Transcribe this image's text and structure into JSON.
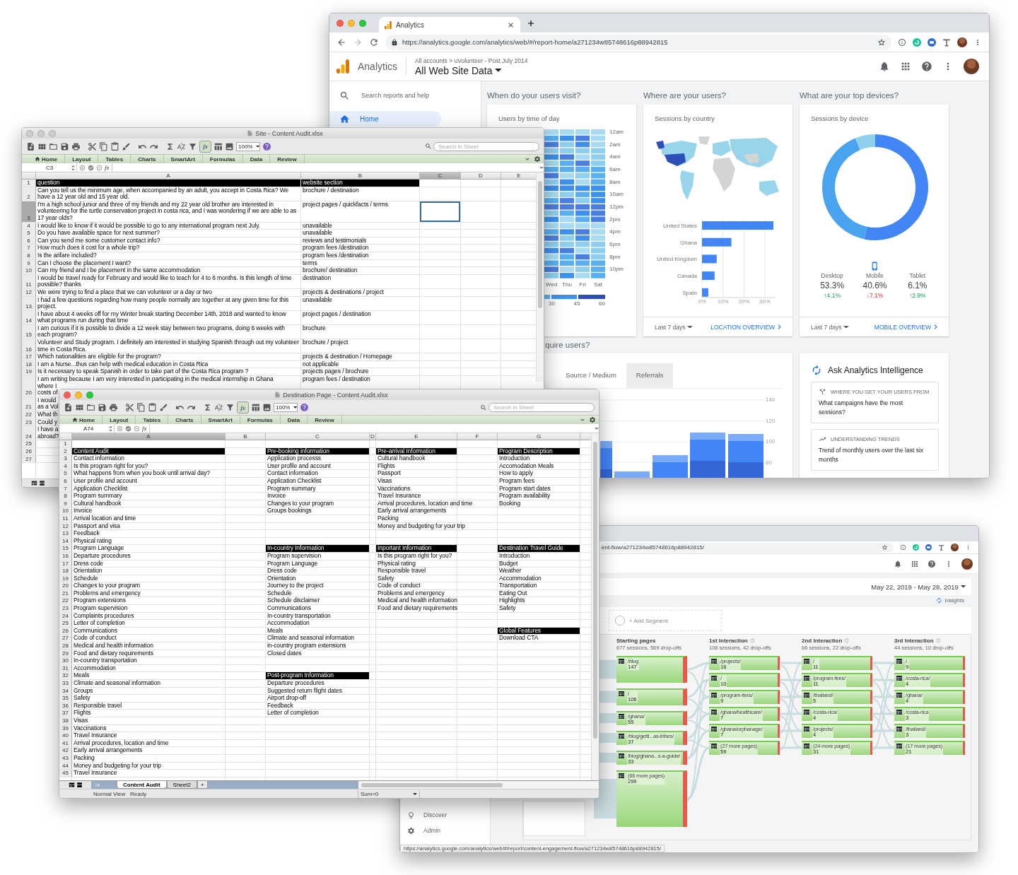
{
  "analytics_window": {
    "tab": {
      "title": "Analytics"
    },
    "url": "https://analytics.google.com/analytics/web/#/report-home/a271234w85748616p88942815",
    "product": "Analytics",
    "breadcrumb": "All accounts > uVolunteer - Post July 2014",
    "view": "All Web Site Data",
    "search": {
      "placeholder": "Search reports and help"
    },
    "sidebar": {
      "items": [
        {
          "label": "Home",
          "selected": true
        }
      ]
    },
    "sections": [
      "When do your users visit?",
      "Where are your users?",
      "What are your top devices?"
    ],
    "time_card": {
      "title": "Users by time of day",
      "hours": [
        "12am",
        "2am",
        "4am",
        "6am",
        "8am",
        "10am",
        "12pm",
        "2pm",
        "4pm",
        "6pm",
        "8pm",
        "10pm"
      ],
      "days": [
        "Wed",
        "Thu",
        "Fri",
        "Sat"
      ],
      "legend": [
        "30",
        "45",
        "60"
      ]
    },
    "country_card": {
      "title": "Sessions by country",
      "range": "Last 7 days",
      "link": "LOCATION OVERVIEW",
      "chart_data": {
        "type": "bar",
        "orientation": "horizontal",
        "grid": true,
        "xlim": [
          0,
          35
        ],
        "categories": [
          "United States",
          "Ghana",
          "United Kingdom",
          "Canada",
          "Spain"
        ],
        "values": [
          34,
          14,
          7,
          6,
          3
        ],
        "xticks": [
          {
            "value": 0,
            "label": "0%"
          },
          {
            "value": 10,
            "label": "10%"
          },
          {
            "value": 20,
            "label": "20%"
          },
          {
            "value": 30,
            "label": "30%"
          }
        ]
      }
    },
    "device_card": {
      "title": "Sessions by device",
      "range": "Last 7 days",
      "link": "MOBILE OVERVIEW",
      "chart_data": {
        "type": "donut",
        "categories": [
          "Desktop",
          "Mobile",
          "Tablet"
        ],
        "values": [
          53.3,
          40.6,
          6.1
        ]
      },
      "devices": [
        {
          "value": "53.3%",
          "change": "↑4.1%",
          "increase": true,
          "selected": false
        },
        {
          "value": "40.6%",
          "change": "↓7.1%",
          "increase": false,
          "selected": true
        },
        {
          "value": "6.1%",
          "change": "↑2.9%",
          "increase": true,
          "selected": false
        }
      ]
    },
    "acquisition": {
      "heading": "quire users?",
      "tabs": [
        {
          "label": "Source / Medium",
          "selected": false,
          "hovered": false
        },
        {
          "label": "Referrals",
          "selected": false,
          "hovered": true
        }
      ],
      "y_labels": [
        "140",
        "120",
        "100",
        "80"
      ]
    },
    "intelligence": {
      "title": "Ask Analytics Intelligence",
      "cards": [
        {
          "kind": "source",
          "topic": "WHERE YOU GET YOUR USERS FROM",
          "question": "What campaigns have the most sessions?"
        },
        {
          "kind": "trend",
          "topic": "UNDERSTANDING TRENDS",
          "question": "Trend of monthly users over the last six months"
        }
      ]
    }
  },
  "flow_window": {
    "url": "ent-flow/a271234w85748616p88942815/",
    "date_range": "May 22, 2019 - May 28, 2019",
    "insights": "Insights",
    "segment": "+ Add Segment",
    "sidebar": {
      "items": [
        {
          "label": "Discover",
          "kind": "discover"
        },
        {
          "label": "Admin",
          "kind": "admin"
        }
      ]
    },
    "columns": [
      {
        "title": "Starting pages",
        "summary": "677 sessions, 569 drop-offs",
        "nodes": [
          {
            "page": "/blog",
            "sessions": "147"
          },
          {
            "page": "/",
            "sessions": "106"
          },
          {
            "page": "/ghana/",
            "sessions": "55"
          },
          {
            "page": "/blog/getti...as-tribes/",
            "sessions": "37"
          },
          {
            "page": "/blog/ghana...s-a-guide/",
            "sessions": "33"
          },
          {
            "page": "(66 more pages)",
            "sessions": "299"
          }
        ]
      },
      {
        "title": "1st Interaction",
        "summary": "108 sessions, 42 drop-offs",
        "nodes": [
          {
            "page": "/projects/",
            "sessions": "16"
          },
          {
            "page": "/",
            "sessions": "10"
          },
          {
            "page": "/program-fees/",
            "sessions": "9"
          },
          {
            "page": "/ghana/healthcare/",
            "sessions": "7"
          },
          {
            "page": "/ghana/orphanage/",
            "sessions": "7"
          },
          {
            "page": "(27 more pages)",
            "sessions": "59"
          }
        ]
      },
      {
        "title": "2nd Interaction",
        "summary": "66 sessions, 22 drop-offs",
        "nodes": [
          {
            "page": "/",
            "sessions": "11"
          },
          {
            "page": "/program-fees/",
            "sessions": "11"
          },
          {
            "page": "/thailand/",
            "sessions": "5"
          },
          {
            "page": "/costa-rica/",
            "sessions": "4"
          },
          {
            "page": "/projects/",
            "sessions": "4"
          },
          {
            "page": "(24 more pages)",
            "sessions": "31"
          }
        ]
      },
      {
        "title": "3rd Interaction",
        "summary": "44 sessions, 10 drop-offs",
        "nodes": [
          {
            "page": "/",
            "sessions": "9"
          },
          {
            "page": "/costa-rica/",
            "sessions": "4"
          },
          {
            "page": "/ghana/",
            "sessions": "4"
          },
          {
            "page": "/costa-rica",
            "sessions": "3"
          },
          {
            "page": "/thailand/",
            "sessions": "3"
          },
          {
            "page": "(17 more pages)",
            "sessions": "21"
          }
        ]
      }
    ],
    "status_url": "https://analytics.google.com/analytics/web/#/report/content-engagement-flow/a271234w85748616p88942815/"
  },
  "site_sheet": {
    "title": "Site - Content Audit.xlsx",
    "active": false,
    "zoom": "100%",
    "toolbar_fx": "fx",
    "formula_fx": "fx",
    "search": {
      "placeholder": "Search in Sheet"
    },
    "ribbon": [
      "Home",
      "Layout",
      "Tables",
      "Charts",
      "SmartArt",
      "Formulas",
      "Data",
      "Review"
    ],
    "cell_ref": "C3",
    "columns": [
      {
        "label": "A",
        "selected": false
      },
      {
        "label": "B",
        "selected": false
      },
      {
        "label": "C",
        "selected": true
      },
      {
        "label": "D",
        "selected": false
      },
      {
        "label": "E",
        "selected": false
      }
    ],
    "rows": [
      {
        "number": "1",
        "selected": false,
        "kind": "header",
        "question": "question",
        "section": "website section"
      },
      {
        "number": "2",
        "selected": false,
        "kind": "plain",
        "question": "Can you tell us the minimum age, when accompanied by an adult, you accept in Costa Rica? We have a 12 year old and 15 year old.",
        "section": "brochure / destination"
      },
      {
        "number": "3",
        "selected": true,
        "kind": "plain",
        "question": "I'm a high school junior and three of my friends and my 22 year old brother are interested in volunteering for the turtle conservation project in costa rica, and I was wondering if we are able to as 17 year olds?",
        "section": "project pages / quickfacts / terms"
      },
      {
        "number": "4",
        "selected": false,
        "kind": "plain",
        "question": "I would like to know if it would be possible to go to any international program next July.",
        "section": "unavailable"
      },
      {
        "number": "5",
        "selected": false,
        "kind": "plain",
        "question": "Do you have available space for next summer?",
        "section": "unavailable"
      },
      {
        "number": "6",
        "selected": false,
        "kind": "plain",
        "question": "Can you send me some customer contact info?",
        "section": "reviews and testimonials"
      },
      {
        "number": "7",
        "selected": false,
        "kind": "plain",
        "question": "How much does it cost for a whole trip?",
        "section": "program fees /destination"
      },
      {
        "number": "8",
        "selected": false,
        "kind": "plain",
        "question": "Is the arifare included?",
        "section": "program fees /destination"
      },
      {
        "number": "9",
        "selected": false,
        "kind": "plain",
        "question": "Can I choose the placement I want?",
        "section": "terms"
      },
      {
        "number": "10",
        "selected": false,
        "kind": "plain",
        "question": "Can my friend and  I be placement in the same accommodation",
        "section": "brochure/ destination"
      },
      {
        "number": "11",
        "selected": false,
        "kind": "plain",
        "question": "I would be travel ready for February and would like to teach for 4 to 6 months. Is this length of time possible? thanks",
        "section": "destination"
      },
      {
        "number": "12",
        "selected": false,
        "kind": "plain",
        "question": "We were trying to find a place that we can volunteer or a day or two",
        "section": "projects & destinations / project"
      },
      {
        "number": "13",
        "selected": false,
        "kind": "plain",
        "question": "I had a few questions regarding how many people normally are together at any given time for this project.",
        "section": "unavailable"
      },
      {
        "number": "14",
        "selected": false,
        "kind": "plain",
        "question": "I have about 4 weeks off for my Winter break starting December 14th, 2018 and wanted to know what programs run during that time",
        "section": "project pages / destination"
      },
      {
        "number": "15",
        "selected": false,
        "kind": "plain",
        "question": "I am curious if it is possible to divide a 12 week stay between two programs, doing 6 weeks with each program?",
        "section": "brochure"
      },
      {
        "number": "16",
        "selected": false,
        "kind": "plain",
        "question": "Volunteer and Study program. I definitely am interested in studying Spanish through out my volunteer time in Costa Rica.",
        "section": "brochure / project"
      },
      {
        "number": "17",
        "selected": false,
        "kind": "plain",
        "question": "Which nationalities are eligible for the program?",
        "section": "projects & destination / Homepage"
      },
      {
        "number": "18",
        "selected": false,
        "kind": "plain",
        "question": "I am a Nurse...thus can help with medical education in Costa Rica",
        "section": "not applicable"
      },
      {
        "number": "19",
        "selected": false,
        "kind": "plain",
        "question": "Is it necessary to speak Spanish in order to take part of the Costa Rica program ?",
        "section": "projects pages / brochure"
      },
      {
        "number": "20",
        "selected": false,
        "kind": "plain",
        "question_lines": [
          "I am writing because I am very interested in participating in the medical internship in Ghana",
          "where I",
          "costs of"
        ],
        "section": "program fees / destination"
      },
      {
        "number": "21",
        "selected": false,
        "kind": "plain",
        "question_lines": [
          "I would",
          "as a Vol"
        ]
      },
      {
        "number": "22",
        "selected": false,
        "kind": "plain",
        "question_lines": [
          "What th"
        ]
      },
      {
        "number": "23",
        "selected": false,
        "kind": "plain",
        "question_lines": [
          "Could y"
        ]
      },
      {
        "number": "24",
        "selected": false,
        "kind": "plain",
        "question_lines": [
          "I have a",
          "abroad?"
        ]
      },
      {
        "number": "25",
        "selected": false,
        "kind": "plain"
      },
      {
        "number": "26",
        "selected": false,
        "kind": "plain"
      },
      {
        "number": "27",
        "selected": false,
        "kind": "plain"
      }
    ]
  },
  "dest_sheet": {
    "title": "Destination Page - Content Audit.xlsx",
    "active": true,
    "zoom": "100%",
    "toolbar_fx": "fx",
    "formula_fx": "fx",
    "search": {
      "placeholder": "Search in Sheet"
    },
    "ribbon": [
      "Home",
      "Layout",
      "Tables",
      "Charts",
      "SmartArt",
      "Formulas",
      "Data",
      "Review"
    ],
    "cell_ref": "A74",
    "columns": [
      {
        "label": "A",
        "selected": true
      },
      {
        "label": "B",
        "selected": false
      },
      {
        "label": "C",
        "selected": false
      },
      {
        "label": "D",
        "selected": false
      },
      {
        "label": "E",
        "selected": false
      },
      {
        "label": "F",
        "selected": false
      },
      {
        "label": "G",
        "selected": false
      }
    ],
    "rows": [
      {
        "number": "1",
        "selected": false
      },
      {
        "number": "2",
        "selected": false,
        "cells": {
          "a": {
            "text": "Content Audit",
            "kind": "header"
          },
          "c": {
            "text": "Pre-booking information",
            "kind": "header"
          },
          "e": {
            "text": "Pre-arrival Information",
            "kind": "header"
          },
          "g": {
            "text": "Program Description",
            "kind": "header"
          }
        }
      },
      {
        "number": "3",
        "selected": false,
        "cells": {
          "a": {
            "text": "Contact information",
            "kind": "plain"
          },
          "c": {
            "text": "Application processs",
            "kind": "plain"
          },
          "e": {
            "text": "Cultural handbook",
            "kind": "plain"
          },
          "g": {
            "text": "Introduction",
            "kind": "plain"
          }
        }
      },
      {
        "number": "4",
        "selected": false,
        "cells": {
          "a": {
            "text": "Is this program right for you?",
            "kind": "plain"
          },
          "c": {
            "text": "User profile and account",
            "kind": "plain"
          },
          "e": {
            "text": "Flights",
            "kind": "plain"
          },
          "g": {
            "text": "Accomodation Meals",
            "kind": "plain"
          }
        }
      },
      {
        "number": "5",
        "selected": false,
        "cells": {
          "a": {
            "text": "What happens from when you book until arrival day?",
            "kind": "plain"
          },
          "c": {
            "text": "Contact information",
            "kind": "plain"
          },
          "e": {
            "text": "Passport",
            "kind": "plain"
          },
          "g": {
            "text": "How to apply",
            "kind": "plain"
          }
        }
      },
      {
        "number": "6",
        "selected": false,
        "cells": {
          "a": {
            "text": "User profile and account",
            "kind": "plain"
          },
          "c": {
            "text": "Application Checklist",
            "kind": "plain"
          },
          "e": {
            "text": "Visas",
            "kind": "plain"
          },
          "g": {
            "text": "Program fees",
            "kind": "plain"
          }
        }
      },
      {
        "number": "7",
        "selected": false,
        "cells": {
          "a": {
            "text": "Application Checklist",
            "kind": "plain"
          },
          "c": {
            "text": "Program summary",
            "kind": "plain"
          },
          "e": {
            "text": "Vaccinations",
            "kind": "plain"
          },
          "g": {
            "text": "Program start dates",
            "kind": "plain"
          }
        }
      },
      {
        "number": "8",
        "selected": false,
        "cells": {
          "a": {
            "text": "Program summary",
            "kind": "plain"
          },
          "c": {
            "text": "Invoice",
            "kind": "plain"
          },
          "e": {
            "text": "Travel Insurance",
            "kind": "plain"
          },
          "g": {
            "text": "Program availability",
            "kind": "plain"
          }
        }
      },
      {
        "number": "9",
        "selected": false,
        "cells": {
          "a": {
            "text": "Cultural handbook",
            "kind": "plain"
          },
          "c": {
            "text": "Changes to your program",
            "kind": "plain"
          },
          "e": {
            "text": "Arrival procedures, location and time",
            "kind": "plain"
          },
          "g": {
            "text": "Booking",
            "kind": "plain"
          }
        }
      },
      {
        "number": "10",
        "selected": false,
        "cells": {
          "a": {
            "text": "Invoice",
            "kind": "plain"
          },
          "c": {
            "text": "Groups bookings",
            "kind": "plain"
          },
          "e": {
            "text": "Early arrival arrangements",
            "kind": "plain"
          }
        }
      },
      {
        "number": "11",
        "selected": false,
        "cells": {
          "a": {
            "text": "Arrival location and time",
            "kind": "plain"
          },
          "e": {
            "text": "Packing",
            "kind": "plain"
          }
        }
      },
      {
        "number": "12",
        "selected": false,
        "cells": {
          "a": {
            "text": "Passport and visa",
            "kind": "plain"
          },
          "e": {
            "text": "Money and budgeting for your trip",
            "kind": "plain"
          }
        }
      },
      {
        "number": "13",
        "selected": false,
        "cells": {
          "a": {
            "text": "Feedback",
            "kind": "plain"
          }
        }
      },
      {
        "number": "14",
        "selected": false,
        "cells": {
          "a": {
            "text": "Physical rating",
            "kind": "plain"
          }
        }
      },
      {
        "number": "15",
        "selected": false,
        "cells": {
          "a": {
            "text": "Program Language",
            "kind": "plain"
          },
          "c": {
            "text": "In-country Information",
            "kind": "header"
          },
          "e": {
            "text": "Inportant Information",
            "kind": "header"
          },
          "g": {
            "text": "Destination Travel Guide",
            "kind": "header"
          }
        }
      },
      {
        "number": "16",
        "selected": false,
        "cells": {
          "a": {
            "text": "Departure procedures",
            "kind": "plain"
          },
          "c": {
            "text": "Program supervision",
            "kind": "plain"
          },
          "e": {
            "text": "Is this program right for you?",
            "kind": "plain"
          },
          "g": {
            "text": "Introduction",
            "kind": "plain"
          }
        }
      },
      {
        "number": "17",
        "selected": false,
        "cells": {
          "a": {
            "text": "Dress code",
            "kind": "plain"
          },
          "c": {
            "text": "Program Language",
            "kind": "plain"
          },
          "e": {
            "text": "Physical rating",
            "kind": "plain"
          },
          "g": {
            "text": "Budget",
            "kind": "plain"
          }
        }
      },
      {
        "number": "18",
        "selected": false,
        "cells": {
          "a": {
            "text": "Orientation",
            "kind": "plain"
          },
          "c": {
            "text": "Dress code",
            "kind": "plain"
          },
          "e": {
            "text": "Responsible travel",
            "kind": "plain"
          },
          "g": {
            "text": "Weather",
            "kind": "plain"
          }
        }
      },
      {
        "number": "19",
        "selected": false,
        "cells": {
          "a": {
            "text": "Schedule",
            "kind": "plain"
          },
          "c": {
            "text": "Orientation",
            "kind": "plain"
          },
          "e": {
            "text": "Safety",
            "kind": "plain"
          },
          "g": {
            "text": "Accommodation",
            "kind": "plain"
          }
        }
      },
      {
        "number": "20",
        "selected": false,
        "cells": {
          "a": {
            "text": "Changes to your program",
            "kind": "plain"
          },
          "c": {
            "text": "Journey to the project",
            "kind": "plain"
          },
          "e": {
            "text": "Code of conduct",
            "kind": "plain"
          },
          "g": {
            "text": "Transportation",
            "kind": "plain"
          }
        }
      },
      {
        "number": "21",
        "selected": false,
        "cells": {
          "a": {
            "text": "Problems and emergency",
            "kind": "plain"
          },
          "c": {
            "text": "Schedule",
            "kind": "plain"
          },
          "e": {
            "text": "Problems and emergency",
            "kind": "plain"
          },
          "g": {
            "text": "Eating Out",
            "kind": "plain"
          }
        }
      },
      {
        "number": "22",
        "selected": false,
        "cells": {
          "a": {
            "text": "Program extensions",
            "kind": "plain"
          },
          "c": {
            "text": "Schedule disclaimer",
            "kind": "plain"
          },
          "e": {
            "text": "Medical and health information",
            "kind": "plain"
          },
          "g": {
            "text": "Highlights",
            "kind": "plain"
          }
        }
      },
      {
        "number": "23",
        "selected": false,
        "cells": {
          "a": {
            "text": "Program supervision",
            "kind": "plain"
          },
          "c": {
            "text": "Communications",
            "kind": "plain"
          },
          "e": {
            "text": "Food and dietary requirements",
            "kind": "plain"
          },
          "g": {
            "text": "Safety",
            "kind": "plain"
          }
        }
      },
      {
        "number": "24",
        "selected": false,
        "cells": {
          "a": {
            "text": "Complaints procedures",
            "kind": "plain"
          },
          "c": {
            "text": "In-country transportation",
            "kind": "plain"
          }
        }
      },
      {
        "number": "25",
        "selected": false,
        "cells": {
          "a": {
            "text": "Letter of completion",
            "kind": "plain"
          },
          "c": {
            "text": "Accommodation",
            "kind": "plain"
          }
        }
      },
      {
        "number": "26",
        "selected": false,
        "cells": {
          "a": {
            "text": "Communications",
            "kind": "plain"
          },
          "c": {
            "text": "Meals",
            "kind": "plain"
          },
          "g": {
            "text": "Global Features",
            "kind": "header"
          }
        }
      },
      {
        "number": "27",
        "selected": false,
        "cells": {
          "a": {
            "text": "Code of conduct",
            "kind": "plain"
          },
          "c": {
            "text": "Climate and seasonal information",
            "kind": "plain"
          },
          "g": {
            "text": "Download CTA",
            "kind": "plain"
          }
        }
      },
      {
        "number": "28",
        "selected": false,
        "cells": {
          "a": {
            "text": "Medical and health information",
            "kind": "plain"
          },
          "c": {
            "text": "in-country program extensions",
            "kind": "plain"
          }
        }
      },
      {
        "number": "29",
        "selected": false,
        "cells": {
          "a": {
            "text": "Food and dietary requirements",
            "kind": "plain"
          },
          "c": {
            "text": "Closed dates",
            "kind": "plain"
          }
        }
      },
      {
        "number": "30",
        "selected": false,
        "cells": {
          "a": {
            "text": "In-country transportation",
            "kind": "plain"
          }
        }
      },
      {
        "number": "31",
        "selected": false,
        "cells": {
          "a": {
            "text": "Accommodation",
            "kind": "plain"
          }
        }
      },
      {
        "number": "32",
        "selected": false,
        "cells": {
          "a": {
            "text": "Meals",
            "kind": "plain"
          },
          "c": {
            "text": "Post-program Information",
            "kind": "header"
          }
        }
      },
      {
        "number": "33",
        "selected": false,
        "cells": {
          "a": {
            "text": "Climate and seasonal information",
            "kind": "plain"
          },
          "c": {
            "text": "Departure procedures",
            "kind": "plain"
          }
        }
      },
      {
        "number": "34",
        "selected": false,
        "cells": {
          "a": {
            "text": "Groups",
            "kind": "plain"
          },
          "c": {
            "text": "Suggested return flight dates",
            "kind": "plain"
          }
        }
      },
      {
        "number": "35",
        "selected": false,
        "cells": {
          "a": {
            "text": "Safety",
            "kind": "plain"
          },
          "c": {
            "text": "Airport drop-off",
            "kind": "plain"
          }
        }
      },
      {
        "number": "36",
        "selected": false,
        "cells": {
          "a": {
            "text": "Responsible travel",
            "kind": "plain"
          },
          "c": {
            "text": "Feedback",
            "kind": "plain"
          }
        }
      },
      {
        "number": "37",
        "selected": false,
        "cells": {
          "a": {
            "text": "Flights",
            "kind": "plain"
          },
          "c": {
            "text": "Letter of completion",
            "kind": "plain"
          }
        }
      },
      {
        "number": "38",
        "selected": false,
        "cells": {
          "a": {
            "text": "Visas",
            "kind": "plain"
          }
        }
      },
      {
        "number": "39",
        "selected": false,
        "cells": {
          "a": {
            "text": "Vaccinations",
            "kind": "plain"
          }
        }
      },
      {
        "number": "40",
        "selected": false,
        "cells": {
          "a": {
            "text": "Travel Insurance",
            "kind": "plain"
          }
        }
      },
      {
        "number": "41",
        "selected": false,
        "cells": {
          "a": {
            "text": "Arrival procedures, location and time",
            "kind": "plain"
          }
        }
      },
      {
        "number": "42",
        "selected": false,
        "cells": {
          "a": {
            "text": "Early arrival arrangements",
            "kind": "plain"
          }
        }
      },
      {
        "number": "43",
        "selected": false,
        "cells": {
          "a": {
            "text": "Packing",
            "kind": "plain"
          }
        }
      },
      {
        "number": "44",
        "selected": false,
        "cells": {
          "a": {
            "text": "Money and budgeting for your trip",
            "kind": "plain"
          }
        }
      },
      {
        "number": "45",
        "selected": false,
        "cells": {
          "a": {
            "text": "Travel Insurance",
            "kind": "plain"
          }
        }
      }
    ],
    "sheet_tabs": [
      {
        "label": "Content Audit",
        "selected": true
      },
      {
        "label": "Sheet2",
        "selected": false
      }
    ],
    "add_sheet": "+",
    "status": {
      "view": "Normal View",
      "state": "Ready",
      "sum": "Sum=0"
    }
  }
}
